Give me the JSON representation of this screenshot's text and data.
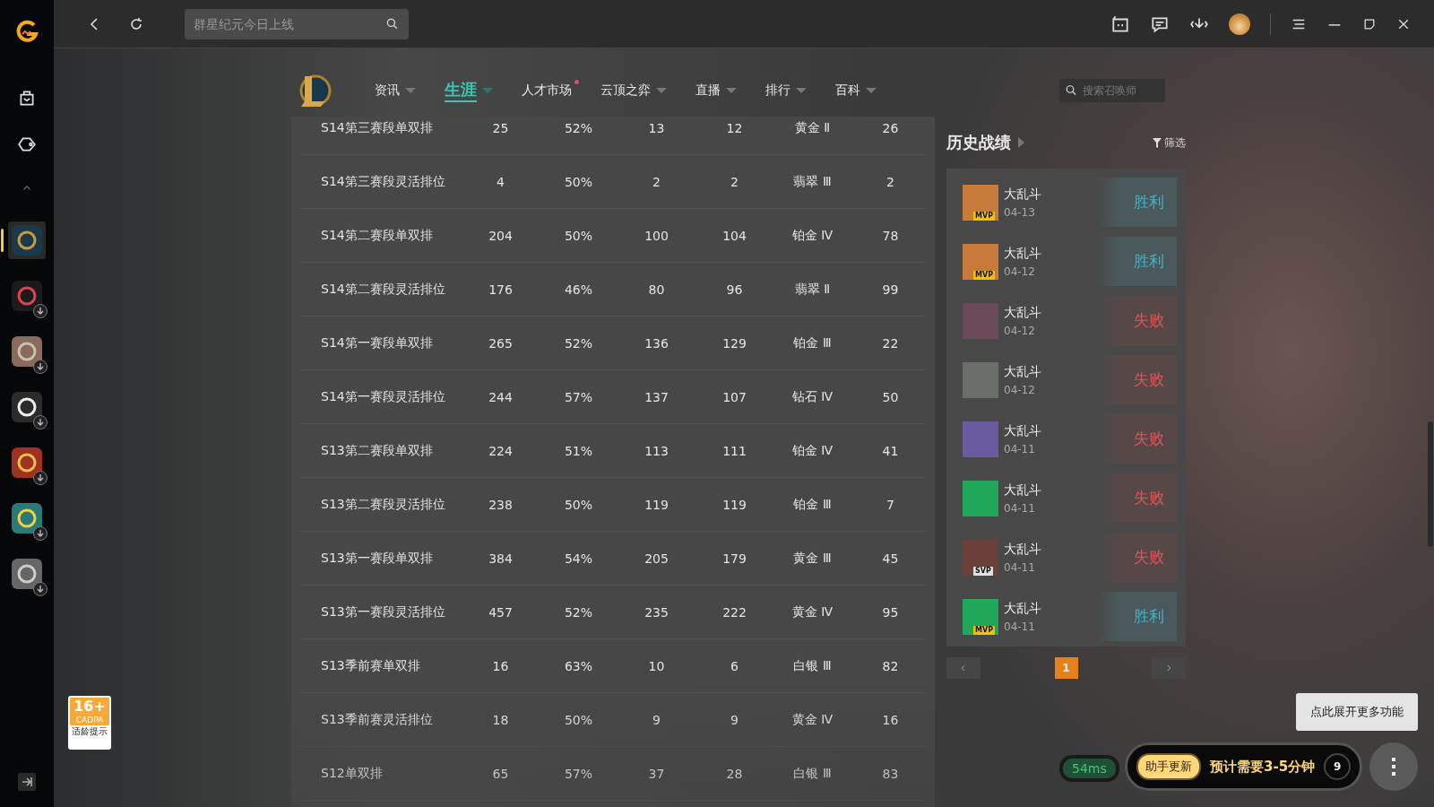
{
  "top_bar": {
    "search": {
      "placeholder": "群星纪元今日上线"
    }
  },
  "sidebar": {
    "games": [
      {
        "selected": true,
        "download_badge": false,
        "kind": "lol"
      },
      {
        "selected": false,
        "download_badge": true,
        "kind": "valorant"
      },
      {
        "selected": false,
        "download_badge": true,
        "kind": "emblem"
      },
      {
        "selected": false,
        "download_badge": true,
        "kind": "star"
      },
      {
        "selected": false,
        "download_badge": true,
        "kind": "cf"
      },
      {
        "selected": false,
        "download_badge": true,
        "kind": "cartoon"
      },
      {
        "selected": false,
        "download_badge": true,
        "kind": "cfhd"
      }
    ]
  },
  "age_rating": {
    "age": "16+",
    "org": "CADPA",
    "label": "适龄提示"
  },
  "nav": {
    "tabs": [
      {
        "label": "资讯",
        "selected": false,
        "dropdown": true,
        "dot": false
      },
      {
        "label": "生涯",
        "selected": true,
        "dropdown": true,
        "dot": false
      },
      {
        "label": "人才市场",
        "selected": false,
        "dropdown": false,
        "dot": true
      },
      {
        "label": "云顶之弈",
        "selected": false,
        "dropdown": true,
        "dot": false
      },
      {
        "label": "直播",
        "selected": false,
        "dropdown": true,
        "dot": false
      },
      {
        "label": "排行",
        "selected": false,
        "dropdown": true,
        "dot": false
      },
      {
        "label": "百科",
        "selected": false,
        "dropdown": true,
        "dot": false
      }
    ],
    "search": {
      "placeholder": "搜索召唤师"
    }
  },
  "table": {
    "rows": [
      [
        "S14第三赛段单双排",
        "25",
        "52%",
        "13",
        "12",
        "黄金 Ⅱ",
        "26"
      ],
      [
        "S14第三赛段灵活排位",
        "4",
        "50%",
        "2",
        "2",
        "翡翠 Ⅲ",
        "2"
      ],
      [
        "S14第二赛段单双排",
        "204",
        "50%",
        "100",
        "104",
        "铂金 Ⅳ",
        "78"
      ],
      [
        "S14第二赛段灵活排位",
        "176",
        "46%",
        "80",
        "96",
        "翡翠 Ⅱ",
        "99"
      ],
      [
        "S14第一赛段单双排",
        "265",
        "52%",
        "136",
        "129",
        "铂金 Ⅲ",
        "22"
      ],
      [
        "S14第一赛段灵活排位",
        "244",
        "57%",
        "137",
        "107",
        "钻石 Ⅳ",
        "50"
      ],
      [
        "S13第二赛段单双排",
        "224",
        "51%",
        "113",
        "111",
        "铂金 Ⅳ",
        "41"
      ],
      [
        "S13第二赛段灵活排位",
        "238",
        "50%",
        "119",
        "119",
        "铂金 Ⅲ",
        "7"
      ],
      [
        "S13第一赛段单双排",
        "384",
        "54%",
        "205",
        "179",
        "黄金 Ⅲ",
        "45"
      ],
      [
        "S13第一赛段灵活排位",
        "457",
        "52%",
        "235",
        "222",
        "黄金 Ⅳ",
        "95"
      ],
      [
        "S13季前赛单双排",
        "16",
        "63%",
        "10",
        "6",
        "白银 Ⅲ",
        "82"
      ],
      [
        "S13季前赛灵活排位",
        "18",
        "50%",
        "9",
        "9",
        "黄金 Ⅳ",
        "16"
      ],
      [
        "S12单双排",
        "65",
        "57%",
        "37",
        "28",
        "白银 Ⅲ",
        "83"
      ]
    ]
  },
  "history": {
    "title": "历史战绩",
    "filter": "筛选",
    "matches": [
      {
        "mode": "大乱斗",
        "date": "04-13",
        "badge": "MVP",
        "result": "胜利",
        "kind": "win",
        "color": "#c87a3a"
      },
      {
        "mode": "大乱斗",
        "date": "04-12",
        "badge": "MVP",
        "result": "胜利",
        "kind": "win",
        "color": "#c87a3a"
      },
      {
        "mode": "大乱斗",
        "date": "04-12",
        "result": "失败",
        "kind": "loss",
        "color": "#6a4a58"
      },
      {
        "mode": "大乱斗",
        "date": "04-12",
        "result": "失败",
        "kind": "loss",
        "color": "#6b6f6a"
      },
      {
        "mode": "大乱斗",
        "date": "04-11",
        "result": "失败",
        "kind": "loss",
        "color": "#6a5aa0"
      },
      {
        "mode": "大乱斗",
        "date": "04-11",
        "result": "失败",
        "kind": "loss",
        "color": "#1fa85a"
      },
      {
        "mode": "大乱斗",
        "date": "04-11",
        "badge": "SVP",
        "result": "失败",
        "kind": "loss",
        "color": "#6a4038"
      },
      {
        "mode": "大乱斗",
        "date": "04-11",
        "badge": "MVP",
        "result": "胜利",
        "kind": "win",
        "color": "#1fa85a"
      }
    ],
    "pages": [
      {
        "label": "1",
        "selected": true
      }
    ]
  },
  "status": {
    "ping": "54ms",
    "update_label": "助手更新",
    "update_text": "预计需要3-5分钟",
    "countdown": "9",
    "tooltip": "点此展开更多功能"
  }
}
